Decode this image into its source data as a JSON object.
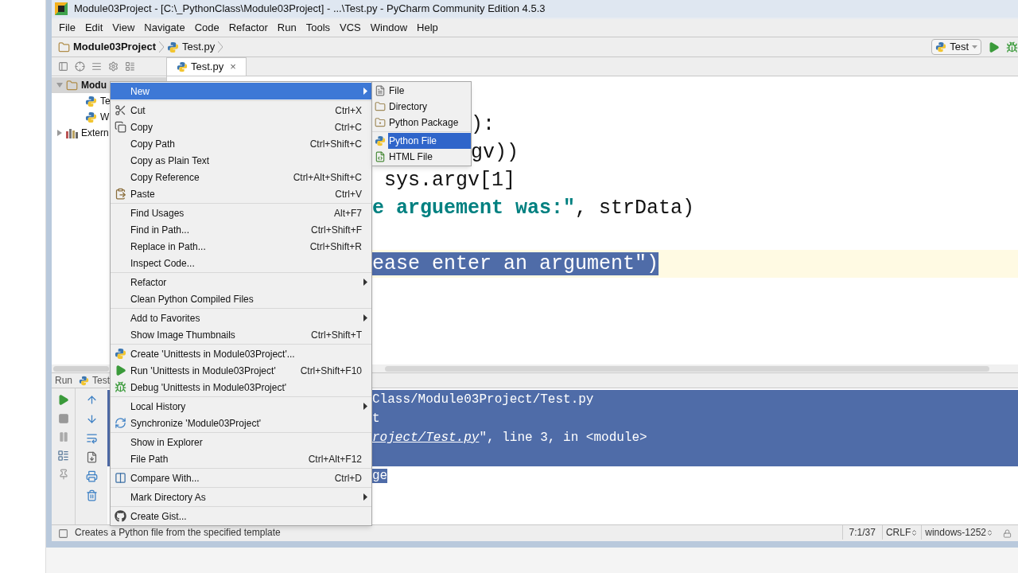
{
  "window": {
    "title": "Module03Project - [C:\\_PythonClass\\Module03Project] - ...\\Test.py - PyCharm Community Edition 4.5.3"
  },
  "menu_bar": [
    "File",
    "Edit",
    "View",
    "Navigate",
    "Code",
    "Refactor",
    "Run",
    "Tools",
    "VCS",
    "Window",
    "Help"
  ],
  "breadcrumb": [
    {
      "label": "Module03Project",
      "kind": "folder"
    },
    {
      "label": "Test.py",
      "kind": "python"
    }
  ],
  "run_config": {
    "label": "Test"
  },
  "editor_tabs": [
    {
      "label": "Test.py",
      "close": "×",
      "selected": true
    }
  ],
  "project_tree": [
    {
      "label": "Modu",
      "kind": "folder",
      "expanded": true,
      "selected": true,
      "children": [
        {
          "label": "Te",
          "kind": "python",
          "selected": false
        },
        {
          "label": "W",
          "kind": "python",
          "selected": false
        }
      ]
    },
    {
      "label": "Extern",
      "kind": "library",
      "expanded": false,
      "selected": false
    }
  ],
  "editor": {
    "lines": [
      {
        "kind": "blank",
        "current": false
      },
      {
        "kind": "after_popup",
        "current": false,
        "segments": [
          {
            "kind": "plain",
            "text": "):"
          }
        ]
      },
      {
        "kind": "after_popup",
        "current": false,
        "segments": [
          {
            "kind": "plain",
            "text": "gv))"
          }
        ]
      },
      {
        "kind": "code",
        "current": false,
        "segments": [
          {
            "kind": "plain",
            "text": " sys.argv[1]"
          }
        ]
      },
      {
        "kind": "code",
        "current": false,
        "segments": [
          {
            "kind": "string",
            "text": "e arguement was:\""
          },
          {
            "kind": "plain",
            "text": ", strData)"
          }
        ]
      },
      {
        "kind": "blank",
        "current": false
      },
      {
        "kind": "code",
        "current": true,
        "segments": [
          {
            "kind": "selected",
            "text": "ease enter an argument\")"
          }
        ]
      }
    ]
  },
  "context_menu": {
    "groups": [
      [
        {
          "label": "New",
          "submenu": true,
          "selected": true
        }
      ],
      [
        {
          "label": "Cut",
          "shortcut": "Ctrl+X",
          "submenu": false,
          "selected": false
        },
        {
          "label": "Copy",
          "shortcut": "Ctrl+C",
          "submenu": false,
          "selected": false
        },
        {
          "label": "Copy Path",
          "shortcut": "Ctrl+Shift+C",
          "submenu": false,
          "selected": false
        },
        {
          "label": "Copy as Plain Text",
          "submenu": false,
          "selected": false
        },
        {
          "label": "Copy Reference",
          "shortcut": "Ctrl+Alt+Shift+C",
          "submenu": false,
          "selected": false
        },
        {
          "label": "Paste",
          "shortcut": "Ctrl+V",
          "submenu": false,
          "selected": false
        }
      ],
      [
        {
          "label": "Find Usages",
          "shortcut": "Alt+F7",
          "submenu": false,
          "selected": false
        },
        {
          "label": "Find in Path...",
          "shortcut": "Ctrl+Shift+F",
          "submenu": false,
          "selected": false
        },
        {
          "label": "Replace in Path...",
          "shortcut": "Ctrl+Shift+R",
          "submenu": false,
          "selected": false
        },
        {
          "label": "Inspect Code...",
          "submenu": false,
          "selected": false
        }
      ],
      [
        {
          "label": "Refactor",
          "submenu": true,
          "selected": false
        },
        {
          "label": "Clean Python Compiled Files",
          "submenu": false,
          "selected": false
        }
      ],
      [
        {
          "label": "Add to Favorites",
          "submenu": true,
          "selected": false
        },
        {
          "label": "Show Image Thumbnails",
          "shortcut": "Ctrl+Shift+T",
          "submenu": false,
          "selected": false
        }
      ],
      [
        {
          "label": "Create 'Unittests in Module03Project'...",
          "submenu": false,
          "selected": false
        },
        {
          "label": "Run 'Unittests in Module03Project'",
          "shortcut": "Ctrl+Shift+F10",
          "submenu": false,
          "selected": false
        },
        {
          "label": "Debug 'Unittests in Module03Project'",
          "submenu": false,
          "selected": false
        }
      ],
      [
        {
          "label": "Local History",
          "submenu": true,
          "selected": false
        },
        {
          "label": "Synchronize 'Module03Project'",
          "submenu": false,
          "selected": false
        }
      ],
      [
        {
          "label": "Show in Explorer",
          "submenu": false,
          "selected": false
        },
        {
          "label": "File Path",
          "shortcut": "Ctrl+Alt+F12",
          "submenu": false,
          "selected": false
        }
      ],
      [
        {
          "label": "Compare With...",
          "shortcut": "Ctrl+D",
          "submenu": false,
          "selected": false
        }
      ],
      [
        {
          "label": "Mark Directory As",
          "submenu": true,
          "selected": false
        }
      ],
      [
        {
          "label": "Create Gist...",
          "submenu": false,
          "selected": false
        }
      ]
    ]
  },
  "submenu": {
    "groups": [
      [
        {
          "label": "File",
          "selected": false
        },
        {
          "label": "Directory",
          "selected": false
        },
        {
          "label": "Python Package",
          "selected": false
        }
      ],
      [
        {
          "label": "Python File",
          "selected": true
        },
        {
          "label": "HTML File",
          "selected": false
        }
      ]
    ]
  },
  "run_panel": {
    "tab": "Run",
    "config": "Test",
    "console_lines": [
      {
        "selected": true,
        "segments": [
          {
            "kind": "plain",
            "text": "Class/Module03Project/Test.py"
          }
        ]
      },
      {
        "selected": true,
        "segments": [
          {
            "kind": "plain",
            "text": "t"
          }
        ]
      },
      {
        "selected": true,
        "segments": [
          {
            "kind": "link",
            "text": "roject/Test.py"
          },
          {
            "kind": "plain",
            "text": "\", line 3, in <module>"
          }
        ]
      },
      {
        "selected": true
      },
      {
        "selected": false,
        "segments": [
          {
            "kind": "selected",
            "text": "ge"
          }
        ]
      }
    ]
  },
  "status_bar": {
    "message": "Creates a Python file from the specified template",
    "position": "7:1/37",
    "line_separator": "CRLF",
    "encoding": "windows-1252"
  }
}
